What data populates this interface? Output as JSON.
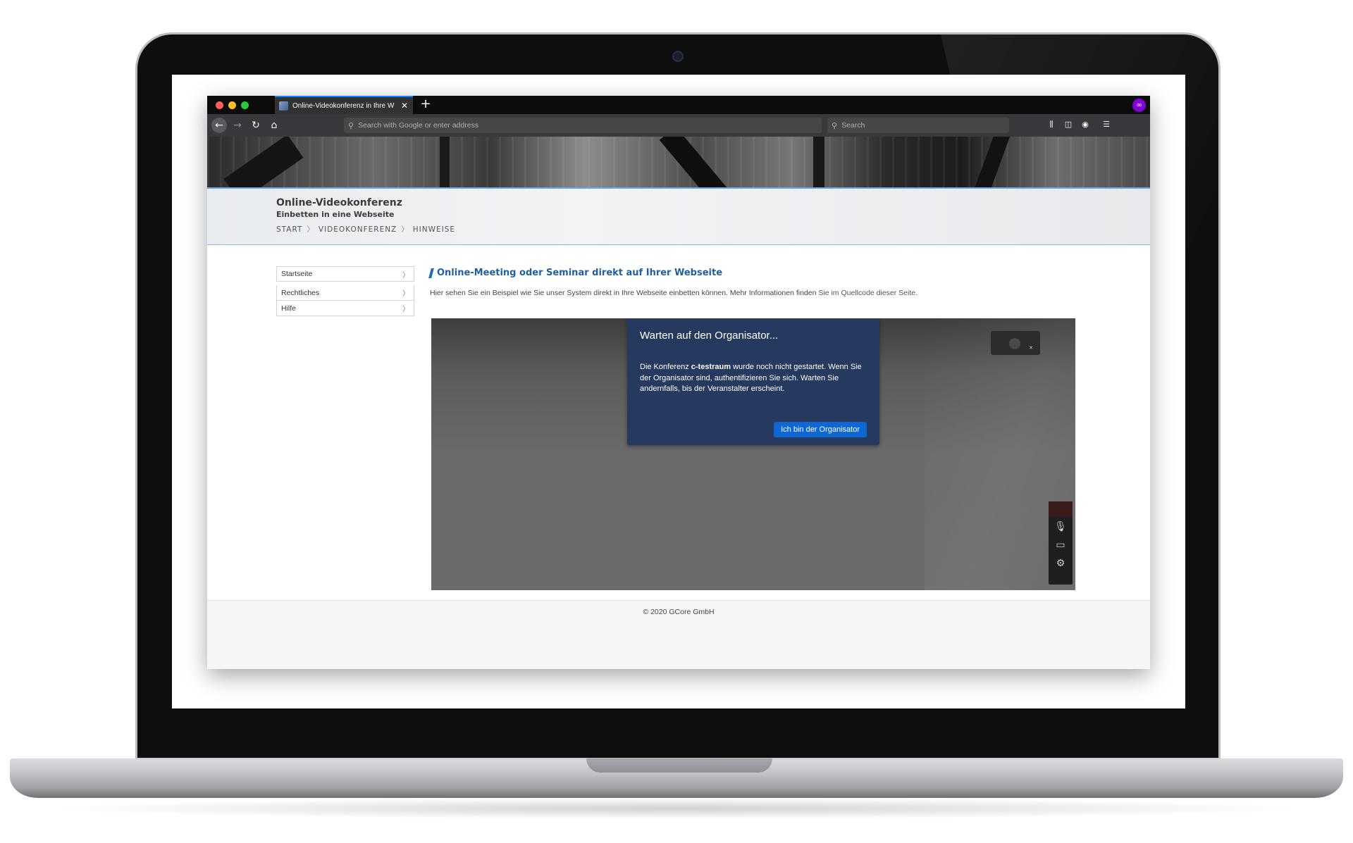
{
  "browser": {
    "tab_title": "Online-Videokonferenz in Ihre W",
    "tab_close": "✕",
    "new_tab": "+",
    "url_placeholder": "Search with Google or enter address",
    "search_placeholder": "Search"
  },
  "site": {
    "title": "Online-Videokonferenz",
    "subtitle": "Einbetten in eine Webseite",
    "breadcrumb": [
      "START",
      "VIDEOKONFERENZ",
      "HINWEISE"
    ],
    "breadcrumb_sep": "〉"
  },
  "sidebar": {
    "items": [
      {
        "label": "Startseite"
      },
      {
        "label": "Rechtliches"
      },
      {
        "label": "Hilfe"
      }
    ],
    "chevron": "〉"
  },
  "main": {
    "heading": "Online-Meeting oder Seminar direkt auf Ihrer Webseite",
    "intro_text": "Hier sehen Sie ein Beispiel wie Sie unser System direkt in Ihre Webseite einbetten können. Mehr Informationen finden",
    "intro_link": "Sie im Quellcode dieser Seite."
  },
  "modal": {
    "title": "Warten auf den Organisator...",
    "body_prefix": "Die Konferenz",
    "room_name": "c-testraum",
    "body_suffix": "wurde noch nicht gestartet. Wenn Sie der Organisator sind, authentifizieren Sie sich. Warten Sie andernfalls, bis der Veranstalter erscheint.",
    "button_label": "Ich bin der Organisator"
  },
  "footer": {
    "copyright": "© 2020 GCore GmbH"
  },
  "colors": {
    "accent": "#1f5fa2",
    "modal_bg": "#253a5e",
    "modal_button": "#0f67d4"
  }
}
